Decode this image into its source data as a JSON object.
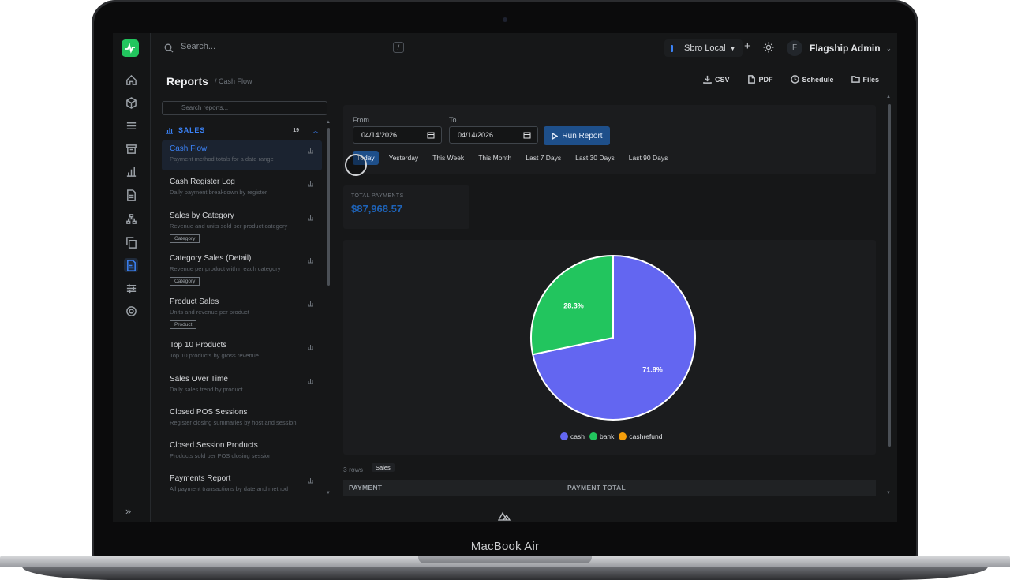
{
  "device": {
    "label": "MacBook Air"
  },
  "topbar": {
    "search_placeholder": "Search...",
    "shortcut_key": "/",
    "environment": "Sbro Local",
    "user_initial": "F",
    "user_name": "Flagship Admin"
  },
  "header": {
    "title": "Reports",
    "breadcrumb": "/ Cash Flow",
    "actions": {
      "csv": "CSV",
      "pdf": "PDF",
      "schedule": "Schedule",
      "files": "Files"
    }
  },
  "sidebar": {
    "search_placeholder": "Search reports...",
    "section": {
      "label": "SALES",
      "count": "19"
    },
    "reports": [
      {
        "name": "Cash Flow",
        "desc": "Payment method totals for a date range",
        "tag": ""
      },
      {
        "name": "Cash Register Log",
        "desc": "Daily payment breakdown by register",
        "tag": ""
      },
      {
        "name": "Sales by Category",
        "desc": "Revenue and units sold per product category",
        "tag": "Category"
      },
      {
        "name": "Category Sales (Detail)",
        "desc": "Revenue per product within each category",
        "tag": "Category"
      },
      {
        "name": "Product Sales",
        "desc": "Units and revenue per product",
        "tag": "Product"
      },
      {
        "name": "Top 10 Products",
        "desc": "Top 10 products by gross revenue",
        "tag": ""
      },
      {
        "name": "Sales Over Time",
        "desc": "Daily sales trend by product",
        "tag": ""
      },
      {
        "name": "Closed POS Sessions",
        "desc": "Register closing summaries by host and session",
        "tag": ""
      },
      {
        "name": "Closed Session Products",
        "desc": "Products sold per POS closing session",
        "tag": ""
      },
      {
        "name": "Payments Report",
        "desc": "All payment transactions by date and method",
        "tag": ""
      }
    ]
  },
  "filters": {
    "from_label": "From",
    "to_label": "To",
    "from_value": "04/14/2026",
    "to_value": "04/14/2026",
    "run_label": "Run Report",
    "quick_ranges": [
      "Today",
      "Yesterday",
      "This Week",
      "This Month",
      "Last 7 Days",
      "Last 30 Days",
      "Last 90 Days"
    ],
    "selected_range": "Today"
  },
  "summary": {
    "label": "TOTAL PAYMENTS",
    "value": "$87,968.57"
  },
  "chart_data": {
    "type": "pie",
    "categories": [
      "cash",
      "bank",
      "cashrefund"
    ],
    "values": [
      71.8,
      28.3,
      0
    ],
    "labels": [
      "71.8%",
      "28.3%",
      ""
    ],
    "colors": [
      "#6366f1",
      "#22c55e",
      "#f59e0b"
    ],
    "legend_position": "bottom"
  },
  "table": {
    "rows_label": "3 rows",
    "tab": "Sales",
    "columns": [
      "PAYMENT",
      "PAYMENT TOTAL"
    ]
  }
}
